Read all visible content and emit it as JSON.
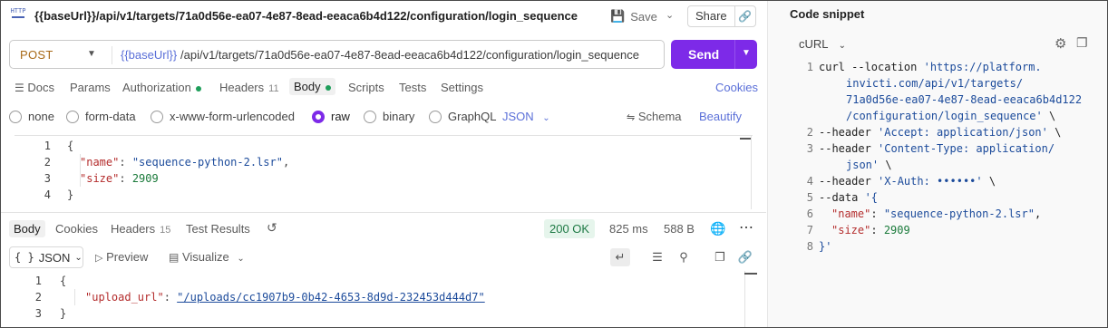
{
  "request": {
    "title": "{{baseUrl}}/api/v1/targets/71a0d56e-ea07-4e87-8ead-eeaca6b4d122/configuration/login_sequence",
    "save_label": "Save",
    "share_label": "Share",
    "method": "POST",
    "url_var": "{{baseUrl}}",
    "url_path": "/api/v1/targets/71a0d56e-ea07-4e87-8ead-eeaca6b4d122/configuration/login_sequence",
    "send_label": "Send",
    "tabs": [
      {
        "label": "Docs"
      },
      {
        "label": "Params"
      },
      {
        "label": "Authorization"
      },
      {
        "label": "Headers",
        "count": "11"
      },
      {
        "label": "Body"
      },
      {
        "label": "Scripts"
      },
      {
        "label": "Tests"
      },
      {
        "label": "Settings"
      }
    ],
    "cookies_label": "Cookies",
    "body_modes": [
      "none",
      "form-data",
      "x-www-form-urlencoded",
      "raw",
      "binary",
      "GraphQL"
    ],
    "body_format": "JSON",
    "schema_label": "Schema",
    "beautify_label": "Beautify",
    "body_lines": [
      "1",
      "2",
      "3",
      "4"
    ],
    "body_name_key": "\"name\"",
    "body_name_val": "\"sequence-python-2.lsr\"",
    "body_size_key": "\"size\"",
    "body_size_val": "2909"
  },
  "response": {
    "tabs": [
      {
        "label": "Body"
      },
      {
        "label": "Cookies"
      },
      {
        "label": "Headers",
        "count": "15"
      },
      {
        "label": "Test Results"
      }
    ],
    "status": "200 OK",
    "time": "825 ms",
    "size": "588 B",
    "format": "JSON",
    "preview_label": "Preview",
    "visualize_label": "Visualize",
    "lines": [
      "1",
      "2",
      "3"
    ],
    "upload_key": "\"upload_url\"",
    "upload_val": "\"/uploads/cc1907b9-0b42-4653-8d9d-232453d444d7\""
  },
  "snippet": {
    "title": "Code snippet",
    "language": "cURL",
    "lines": [
      "1",
      "2",
      "3",
      "4",
      "5",
      "6",
      "7",
      "8"
    ],
    "l1a": "curl --location ",
    "l1b": "'https://platform.",
    "l1c": "invicti.com/api/v1/targets/",
    "l1d": "71a0d56e-ea07-4e87-8ead-eeaca6b4d122",
    "l1e": "/configuration/login_sequence'",
    "l1f": " \\",
    "l2a": "--header ",
    "l2b": "'Accept: application/json'",
    "l2c": " \\",
    "l3a": "--header ",
    "l3b": "'Content-Type: application/",
    "l3c": "json'",
    "l3d": " \\",
    "l4a": "--header ",
    "l4b": "'X-Auth: ••••••'",
    "l4c": " \\",
    "l5a": "--data ",
    "l5b": "'{",
    "l6a": "\"name\"",
    "l6b": ": ",
    "l6c": "\"sequence-python-2.lsr\"",
    "l6d": ",",
    "l7a": "\"size\"",
    "l7b": ": ",
    "l7c": "2909",
    "l8a": "}'"
  }
}
